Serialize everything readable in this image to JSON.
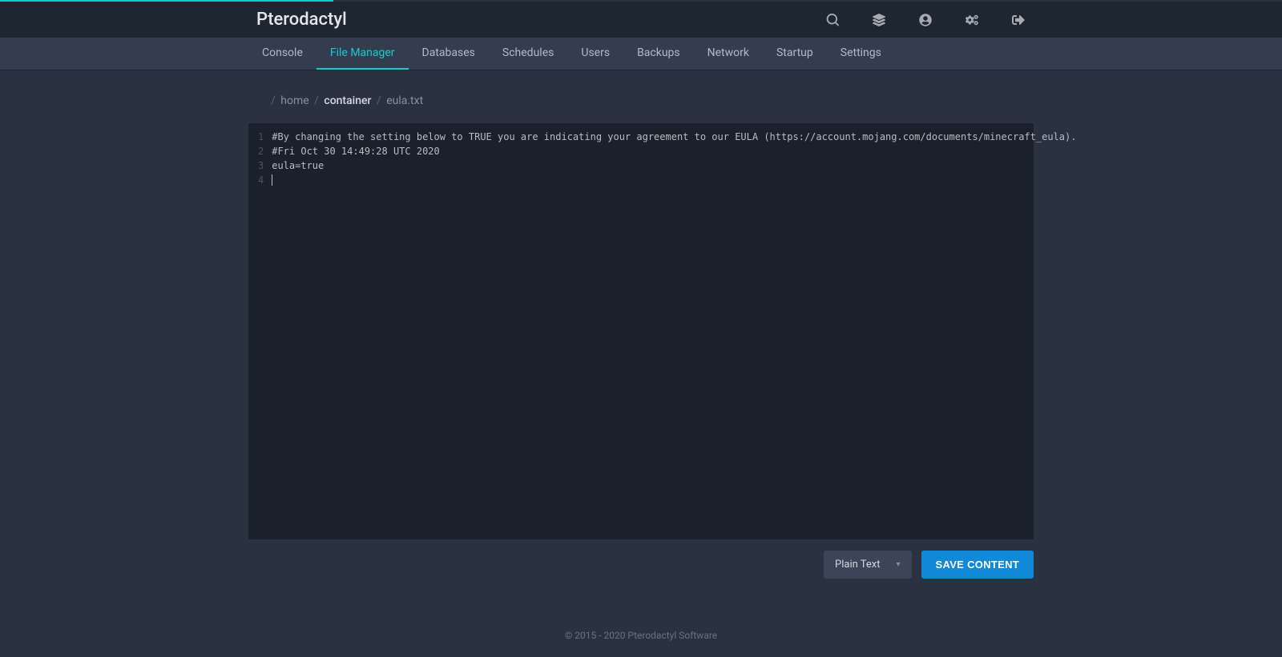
{
  "brand": "Pterodactyl",
  "subnav": {
    "items": [
      "Console",
      "File Manager",
      "Databases",
      "Schedules",
      "Users",
      "Backups",
      "Network",
      "Startup",
      "Settings"
    ],
    "active": 1
  },
  "breadcrumb": {
    "segments": [
      "home",
      "container",
      "eula.txt"
    ],
    "strong_index": 1
  },
  "editor": {
    "lines": [
      "#By changing the setting below to TRUE you are indicating your agreement to our EULA (https://account.mojang.com/documents/minecraft_eula).",
      "#Fri Oct 30 14:49:28 UTC 2020",
      "eula=true",
      ""
    ]
  },
  "mode_selector": {
    "value": "Plain Text"
  },
  "save_button": "SAVE CONTENT",
  "footer": "© 2015 - 2020 Pterodactyl Software"
}
